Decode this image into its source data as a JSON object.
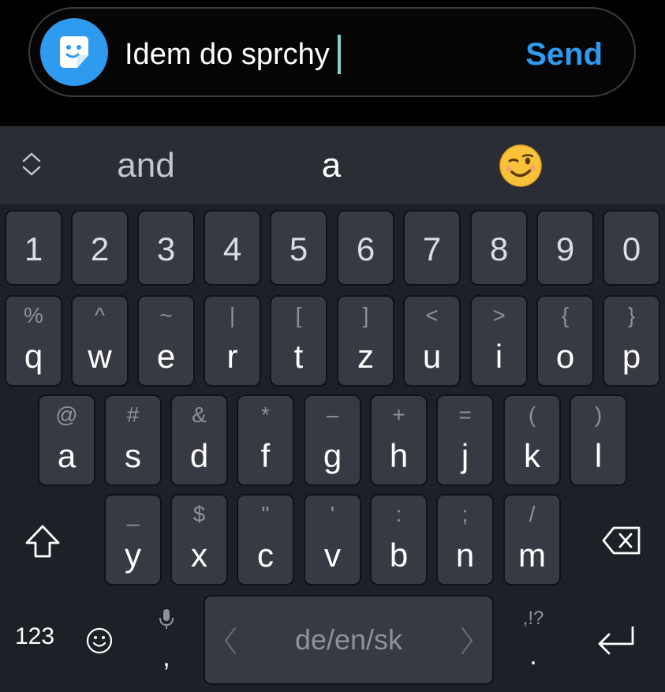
{
  "compose": {
    "text": "Idem do sprchy",
    "send_label": "Send"
  },
  "suggestions": {
    "left": "and",
    "middle": "a",
    "emoji": "😉"
  },
  "number_row": [
    "1",
    "2",
    "3",
    "4",
    "5",
    "6",
    "7",
    "8",
    "9",
    "0"
  ],
  "row1": [
    {
      "hint": "%",
      "key": "q"
    },
    {
      "hint": "^",
      "key": "w"
    },
    {
      "hint": "~",
      "key": "e"
    },
    {
      "hint": "|",
      "key": "r"
    },
    {
      "hint": "[",
      "key": "t"
    },
    {
      "hint": "]",
      "key": "z"
    },
    {
      "hint": "<",
      "key": "u"
    },
    {
      "hint": ">",
      "key": "i"
    },
    {
      "hint": "{",
      "key": "o"
    },
    {
      "hint": "}",
      "key": "p"
    }
  ],
  "row2": [
    {
      "hint": "@",
      "key": "a"
    },
    {
      "hint": "#",
      "key": "s"
    },
    {
      "hint": "&",
      "key": "d"
    },
    {
      "hint": "*",
      "key": "f"
    },
    {
      "hint": "–",
      "key": "g"
    },
    {
      "hint": "+",
      "key": "h"
    },
    {
      "hint": "=",
      "key": "j"
    },
    {
      "hint": "(",
      "key": "k"
    },
    {
      "hint": ")",
      "key": "l"
    }
  ],
  "row3": [
    {
      "hint": "_",
      "key": "y"
    },
    {
      "hint": "$",
      "key": "x"
    },
    {
      "hint": "\"",
      "key": "c"
    },
    {
      "hint": "'",
      "key": "v"
    },
    {
      "hint": ":",
      "key": "b"
    },
    {
      "hint": ";",
      "key": "n"
    },
    {
      "hint": "/",
      "key": "m"
    }
  ],
  "bottom": {
    "numbers_label": "123",
    "comma_label": ",",
    "space_label": "de/en/sk",
    "punct_hint": ",!?",
    "period_label": "."
  },
  "icons": {
    "sticker": "sticker-icon",
    "suggest_toggle": "chevron-updown-icon",
    "shift": "shift-icon",
    "backspace": "backspace-icon",
    "emoji": "smiley-icon",
    "mic": "microphone-icon",
    "enter": "enter-icon"
  },
  "colors": {
    "accent": "#2f9bf0",
    "caret": "#7fd6c9",
    "key_bg": "#383a43",
    "keyboard_bg": "#1e2027",
    "suggest_bg": "#2b2d35"
  }
}
